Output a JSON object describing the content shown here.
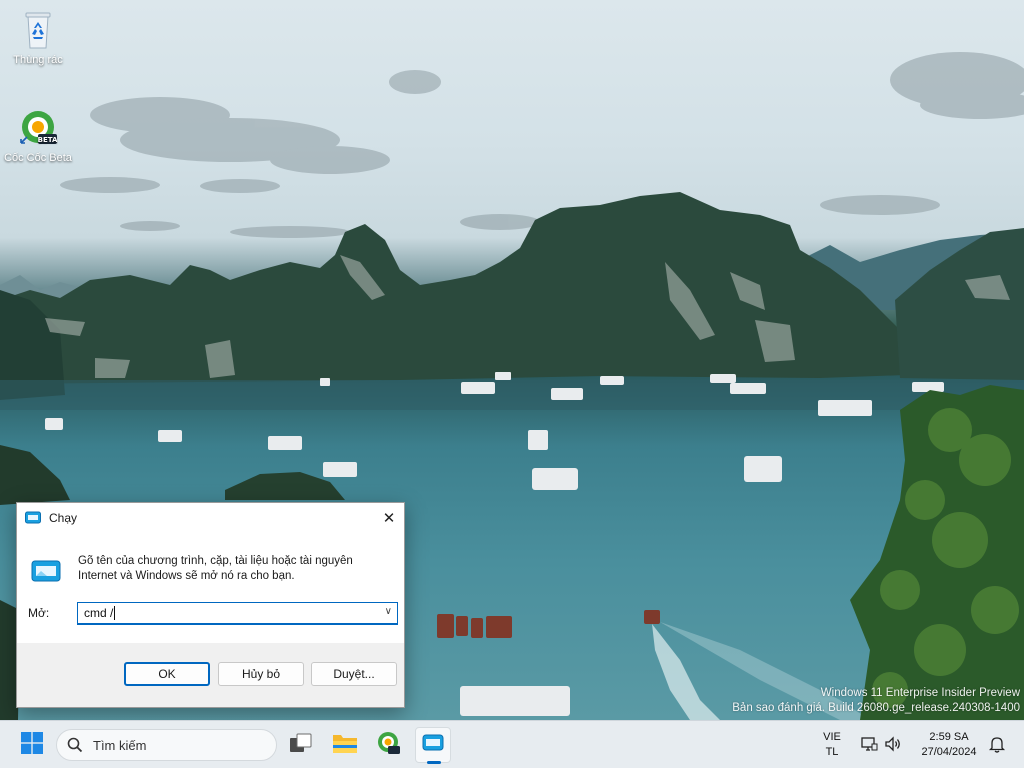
{
  "desktop": {
    "icons": [
      {
        "label": "Thùng rác",
        "icon": "recycle-bin-icon"
      },
      {
        "label": "Cốc Cốc Beta",
        "icon": "coccoc-beta-icon"
      }
    ],
    "watermark": {
      "line1": "Windows 11 Enterprise Insider Preview",
      "line2": "Bản sao đánh giá. Build 26080.ge_release.240308-1400"
    }
  },
  "run_dialog": {
    "title": "Chạy",
    "close_label": "✕",
    "description": "Gõ tên của chương trình, cặp, tài liệu hoặc tài nguyên Internet và Windows sẽ mở nó ra cho bạn.",
    "open_label": "Mở:",
    "open_value": "cmd /",
    "ok_label": "OK",
    "cancel_label": "Hủy bỏ",
    "browse_label": "Duyệt..."
  },
  "taskbar": {
    "search_placeholder": "Tìm kiếm",
    "language_line1": "VIE",
    "language_line2": "TL",
    "time": "2:59 SA",
    "date": "27/04/2024",
    "accent": "#0067c0"
  }
}
